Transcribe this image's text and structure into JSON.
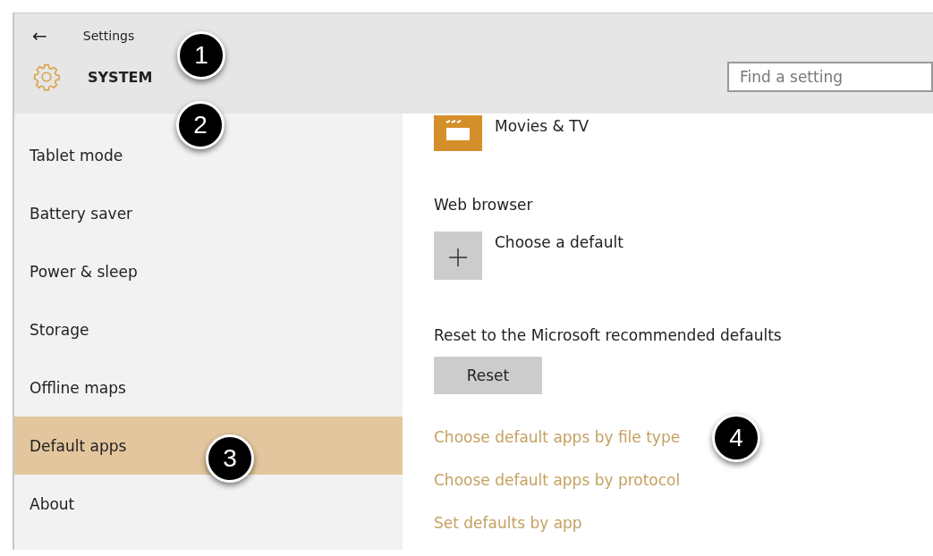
{
  "window": {
    "back_glyph": "←",
    "title": "Settings"
  },
  "header": {
    "section": "SYSTEM",
    "search": {
      "placeholder": "Find a setting"
    }
  },
  "sidebar": {
    "items": [
      {
        "label": "Tablet mode",
        "selected": false
      },
      {
        "label": "Battery saver",
        "selected": false
      },
      {
        "label": "Power & sleep",
        "selected": false
      },
      {
        "label": "Storage",
        "selected": false
      },
      {
        "label": "Offline maps",
        "selected": false
      },
      {
        "label": "Default apps",
        "selected": true
      },
      {
        "label": "About",
        "selected": false
      }
    ]
  },
  "content": {
    "video_player": {
      "app": "Movies & TV"
    },
    "web_browser": {
      "heading": "Web browser",
      "app": "Choose a default"
    },
    "reset": {
      "heading": "Reset to the Microsoft recommended defaults",
      "button": "Reset"
    },
    "links": [
      "Choose default apps by file type",
      "Choose default apps by protocol",
      "Set defaults by app"
    ]
  },
  "callouts": [
    "1",
    "2",
    "3",
    "4"
  ]
}
